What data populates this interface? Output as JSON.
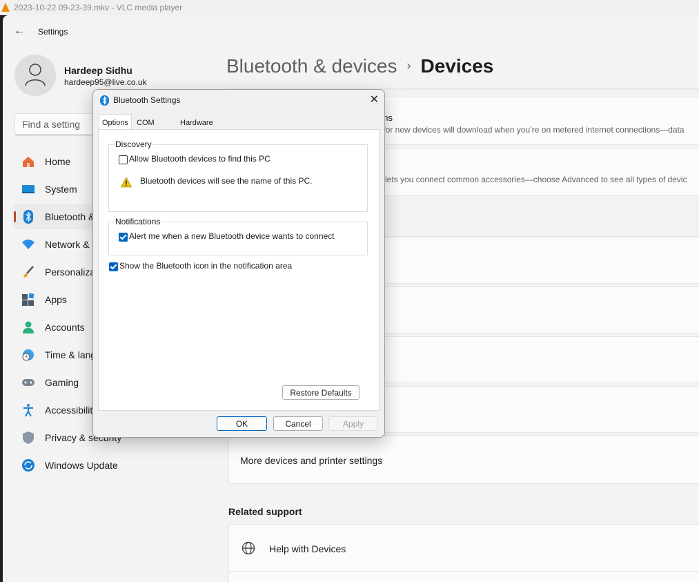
{
  "vlc": {
    "title": "2023-10-22 09-23-39.mkv - VLC media player"
  },
  "settings": {
    "app_title": "Settings",
    "user": {
      "name": "Hardeep Sidhu",
      "email": "hardeep95@live.co.uk"
    },
    "search_placeholder": "Find a setting",
    "nav": [
      {
        "label": "Home",
        "icon": "home-icon",
        "active": false
      },
      {
        "label": "System",
        "icon": "display-icon",
        "active": false
      },
      {
        "label": "Bluetooth & devices",
        "icon": "bluetooth-icon",
        "active": true
      },
      {
        "label": "Network & internet",
        "icon": "wifi-icon",
        "active": false
      },
      {
        "label": "Personalization",
        "icon": "brush-icon",
        "active": false
      },
      {
        "label": "Apps",
        "icon": "apps-icon",
        "active": false
      },
      {
        "label": "Accounts",
        "icon": "person-icon",
        "active": false
      },
      {
        "label": "Time & language",
        "icon": "globe-clock-icon",
        "active": false
      },
      {
        "label": "Gaming",
        "icon": "gamepad-icon",
        "active": false
      },
      {
        "label": "Accessibility",
        "icon": "accessibility-icon",
        "active": false
      },
      {
        "label": "Privacy & security",
        "icon": "shield-icon",
        "active": false
      },
      {
        "label": "Windows Update",
        "icon": "update-icon",
        "active": false
      }
    ],
    "breadcrumb": {
      "parent": "Bluetooth & devices",
      "separator": "›",
      "current": "Devices"
    },
    "cards": {
      "metered_title": "ons",
      "metered_sub": "s) for new devices will download when you’re on metered internet connections—data",
      "discovery_sub": "ult lets you connect common accessories—choose Advanced to see all types of devic",
      "more_devices": "More devices and printer settings"
    },
    "related": {
      "heading": "Related support",
      "help_devices": "Help with Devices"
    }
  },
  "dialog": {
    "title": "Bluetooth Settings",
    "tabs": [
      "Options",
      "COM Ports",
      "Hardware"
    ],
    "discovery": {
      "legend": "Discovery",
      "allow_label": "Allow Bluetooth devices to find this PC",
      "allow_checked": false,
      "warning": "Bluetooth devices will see the name of this PC."
    },
    "notifications": {
      "legend": "Notifications",
      "alert_label": "Alert me when a new Bluetooth device wants to connect",
      "alert_checked": true
    },
    "show_icon_label": "Show the Bluetooth icon in the notification area",
    "show_icon_checked": true,
    "restore": "Restore Defaults",
    "ok": "OK",
    "cancel": "Cancel",
    "apply": "Apply"
  }
}
